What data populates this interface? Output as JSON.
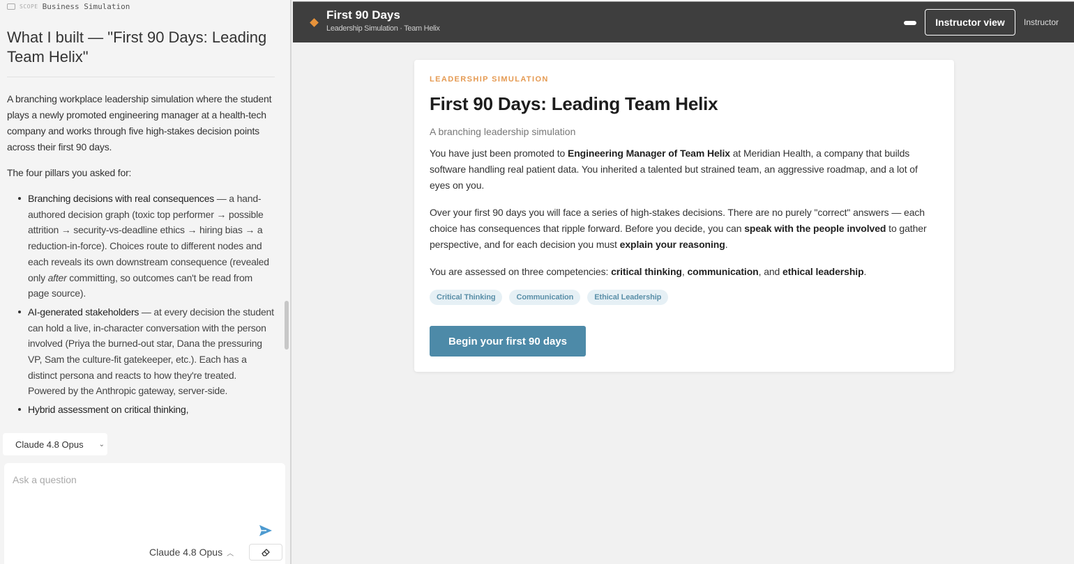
{
  "scope": {
    "label": "SCOPE",
    "value": "Business Simulation"
  },
  "chat": {
    "title": "What I built — \"First 90 Days: Leading Team Helix\"",
    "intro": "A branching workplace leadership simulation where the student plays a newly promoted engineering manager at a health-tech company and works through five high-stakes decision points across their first 90 days.",
    "pillars_heading": "The four pillars you asked for:",
    "pillars": [
      {
        "head": "Branching decisions with real consequences",
        "text_a": " — a hand-authored decision graph (toxic top performer → possible attrition → security-vs-deadline ethics → hiring bias → a reduction-in-force). Choices route to different nodes and each reveals its own downstream consequence (revealed only ",
        "emph": "after",
        "text_b": " committing, so outcomes can't be read from page source)."
      },
      {
        "head": "AI-generated stakeholders",
        "text_a": " — at every decision the student can hold a live, in-character conversation with the person involved (Priya the burned-out star, Dana the pressuring VP, Sam the culture-fit gatekeeper, etc.). Each has a distinct persona and reacts to how they're treated. Powered by the Anthropic gateway, server-side.",
        "emph": "",
        "text_b": ""
      },
      {
        "head": "Hybrid assessment on critical thinking,",
        "text_a": "",
        "emph": "",
        "text_b": ""
      }
    ]
  },
  "composer": {
    "model_top": "Claude 4.8 Opus",
    "placeholder": "Ask a question",
    "model_bottom": "Claude 4.8 Opus"
  },
  "app": {
    "title": "First 90 Days",
    "subtitle": "Leadership Simulation · Team Helix",
    "instructor_button": "Instructor view",
    "instructor_label": "Instructor"
  },
  "card": {
    "eyebrow": "LEADERSHIP SIMULATION",
    "title": "First 90 Days: Leading Team Helix",
    "subtitle": "A branching leadership simulation",
    "p1_a": "You have just been promoted to ",
    "p1_b": "Engineering Manager of Team Helix",
    "p1_c": " at Meridian Health, a company that builds software handling real patient data. You inherited a talented but strained team, an aggressive roadmap, and a lot of eyes on you.",
    "p2_a": "Over your first 90 days you will face a series of high-stakes decisions. There are no purely \"correct\" answers — each choice has consequences that ripple forward. Before you decide, you can ",
    "p2_b": "speak with the people involved",
    "p2_c": " to gather perspective, and for each decision you must ",
    "p2_d": "explain your reasoning",
    "p2_e": ".",
    "p3_a": "You are assessed on three competencies: ",
    "p3_b": "critical thinking",
    "p3_c": ", ",
    "p3_d": "communication",
    "p3_e": ", and ",
    "p3_f": "ethical leadership",
    "p3_g": ".",
    "tags": [
      "Critical Thinking",
      "Communication",
      "Ethical Leadership"
    ],
    "begin_button": "Begin your first 90 days"
  },
  "colors": {
    "accent": "#4d8aa8",
    "eyebrow": "#e59a52",
    "topbar": "#3e3e3e",
    "diamond": "#e8933a"
  }
}
